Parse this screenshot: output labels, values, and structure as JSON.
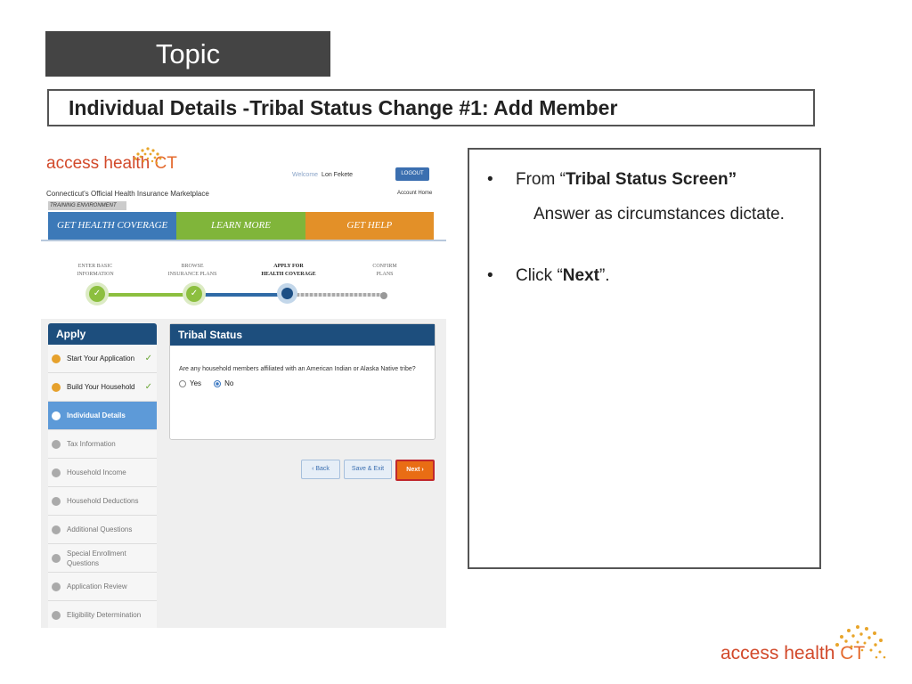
{
  "slide": {
    "topic": "Topic",
    "title": "Individual Details -Tribal Status Change #1:  Add Member"
  },
  "app": {
    "logo_text": "access health",
    "logo_ct": "CT",
    "tagline": "Connecticut's Official Health Insurance Marketplace",
    "environment": "TRAINING ENVIRONMENT",
    "welcome_label": "Welcome",
    "user_name": "Lon Fekete",
    "logout_label": "LOGOUT",
    "account_home": "Account Home",
    "nav": [
      "GET HEALTH COVERAGE",
      "LEARN MORE",
      "GET HELP"
    ],
    "steps": [
      {
        "line1": "ENTER BASIC",
        "line2": "INFORMATION"
      },
      {
        "line1": "BROWSE",
        "line2": "INSURANCE PLANS"
      },
      {
        "line1": "APPLY FOR",
        "line2": "HEALTH COVERAGE"
      },
      {
        "line1": "CONFIRM",
        "line2": "PLANS"
      }
    ],
    "sidebar": {
      "title": "Apply",
      "items": [
        "Start Your Application",
        "Build Your Household",
        "Individual Details",
        "Tax Information",
        "Household Income",
        "Household Deductions",
        "Additional Questions",
        "Special Enrollment Questions",
        "Application Review",
        "Eligibility Determination"
      ]
    },
    "panel": {
      "title": "Tribal Status",
      "question": "Are any household members affiliated with an American Indian or Alaska Native tribe?",
      "option_yes": "Yes",
      "option_no": "No",
      "selected": "No"
    },
    "buttons": {
      "back": "‹ Back",
      "save_exit": "Save & Exit",
      "next": "Next ›"
    }
  },
  "notes": {
    "bullet1_prefix": "From “",
    "bullet1_bold": "Tribal Status Screen”",
    "bullet1_cont": "Answer as circumstances dictate.",
    "bullet2_prefix": "Click “",
    "bullet2_bold": "Next",
    "bullet2_suffix": "”."
  },
  "footer": {
    "logo_text": "access health",
    "logo_ct": "CT"
  },
  "colors": {
    "brand_orange": "#e46a2e",
    "nav_blue": "#3c79b8",
    "nav_green": "#80b53a",
    "nav_orange": "#e39028",
    "header_navy": "#1d4e7d",
    "next_orange": "#e96d14"
  }
}
